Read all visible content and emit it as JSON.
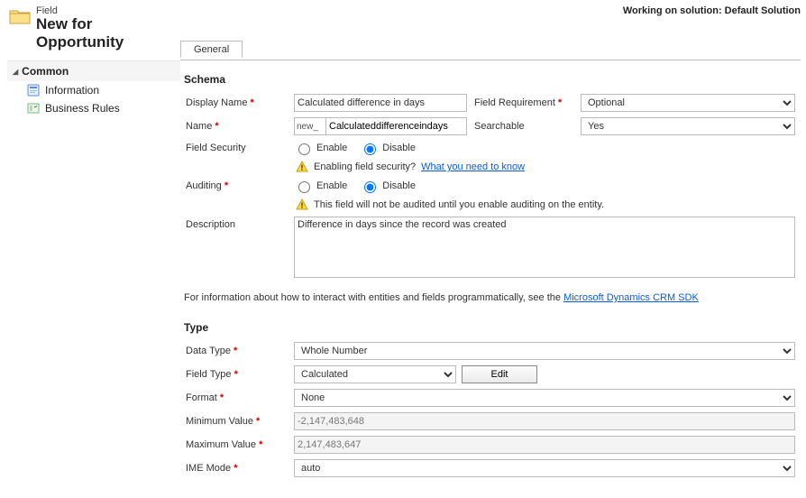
{
  "solution_bar": "Working on solution: Default Solution",
  "header": {
    "small": "Field",
    "title": "New for Opportunity"
  },
  "nav": {
    "section": "Common",
    "items": [
      {
        "label": "Information"
      },
      {
        "label": "Business Rules"
      }
    ]
  },
  "tab": {
    "general": "General"
  },
  "sections": {
    "schema": "Schema",
    "type": "Type"
  },
  "labels": {
    "display_name": "Display Name",
    "field_requirement": "Field Requirement",
    "name": "Name",
    "searchable": "Searchable",
    "field_security": "Field Security",
    "auditing": "Auditing",
    "description": "Description",
    "data_type": "Data Type",
    "field_type": "Field Type",
    "format": "Format",
    "min_value": "Minimum Value",
    "max_value": "Maximum Value",
    "ime_mode": "IME Mode"
  },
  "radio": {
    "enable": "Enable",
    "disable": "Disable"
  },
  "values": {
    "display_name": "Calculated difference in days",
    "field_requirement": "Optional",
    "name_prefix": "new_",
    "name_rest": "Calculateddifferenceindays",
    "searchable": "Yes",
    "description": "Difference in days since the record was created",
    "data_type": "Whole Number",
    "field_type": "Calculated",
    "format": "None",
    "min_value": "-2,147,483,648",
    "max_value": "2,147,483,647",
    "ime_mode": "auto"
  },
  "warnings": {
    "security_prefix": "Enabling field security? ",
    "security_link": "What you need to know",
    "auditing": "This field will not be audited until you enable auditing on the entity."
  },
  "info_line_prefix": "For information about how to interact with entities and fields programmatically, see the ",
  "info_line_link": "Microsoft Dynamics CRM SDK",
  "buttons": {
    "edit": "Edit"
  }
}
